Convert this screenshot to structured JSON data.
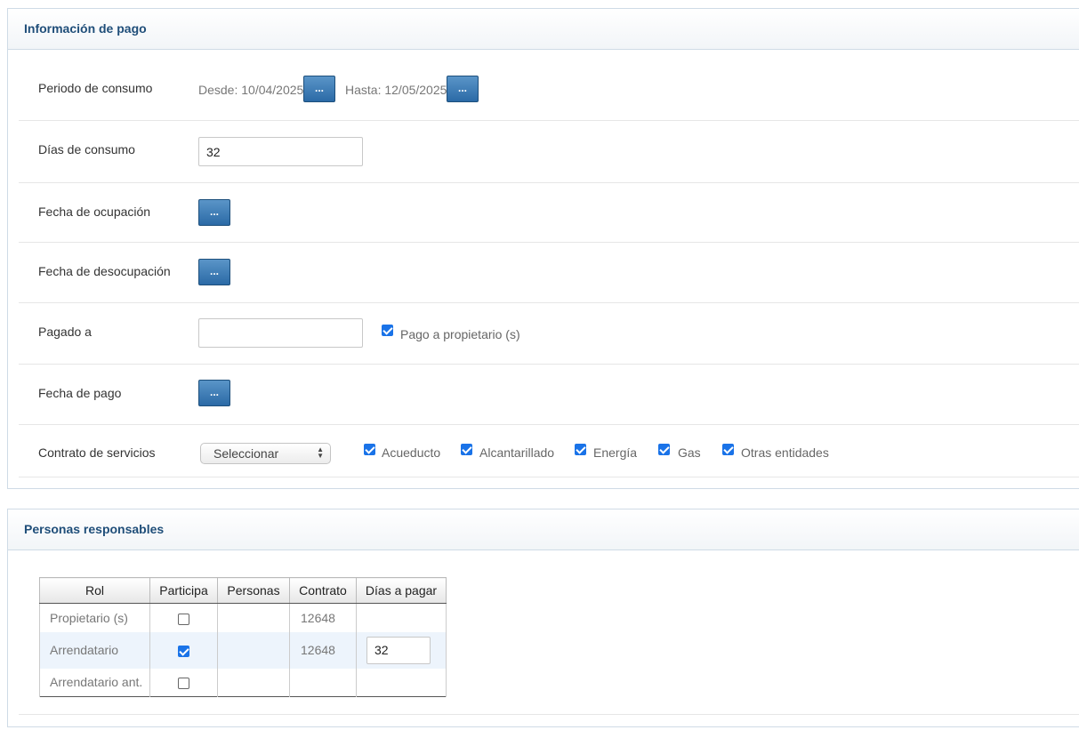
{
  "payment_panel": {
    "title": "Información de pago",
    "consumption_period": {
      "label": "Periodo de consumo",
      "from_text": "Desde: 10/04/2025",
      "to_text": "Hasta: 12/05/2025",
      "button_label": "..."
    },
    "consumption_days": {
      "label": "Días de consumo",
      "value": "32"
    },
    "occupation_date": {
      "label": "Fecha de ocupación",
      "button_label": "..."
    },
    "vacate_date": {
      "label": "Fecha de desocupación",
      "button_label": "..."
    },
    "paid_to": {
      "label": "Pagado a",
      "value": "",
      "owner_payment_label": "Pago a propietario (s)",
      "owner_payment_checked": true
    },
    "payment_date": {
      "label": "Fecha de pago",
      "button_label": "..."
    },
    "service_contract": {
      "label": "Contrato de servicios",
      "select_value": "Seleccionar",
      "services": [
        {
          "label": "Acueducto",
          "checked": true
        },
        {
          "label": "Alcantarillado",
          "checked": true
        },
        {
          "label": "Energía",
          "checked": true
        },
        {
          "label": "Gas",
          "checked": true
        },
        {
          "label": "Otras entidades",
          "checked": true
        }
      ]
    }
  },
  "responsible_panel": {
    "title": "Personas responsables",
    "columns": [
      "Rol",
      "Participa",
      "Personas",
      "Contrato",
      "Días a pagar"
    ],
    "rows": [
      {
        "role": "Propietario (s)",
        "participates": false,
        "persons": "",
        "contract": "12648",
        "days": ""
      },
      {
        "role": "Arrendatario",
        "participates": true,
        "persons": "",
        "contract": "12648",
        "days": "32"
      },
      {
        "role": "Arrendatario ant.",
        "participates": false,
        "persons": "",
        "contract": "",
        "days": ""
      }
    ]
  },
  "colors": {
    "header_text": "#1f4e79",
    "button_blue": "#2b6aa6",
    "checkbox_blue": "#1a73e8",
    "row_highlight": "#edf4fc"
  }
}
